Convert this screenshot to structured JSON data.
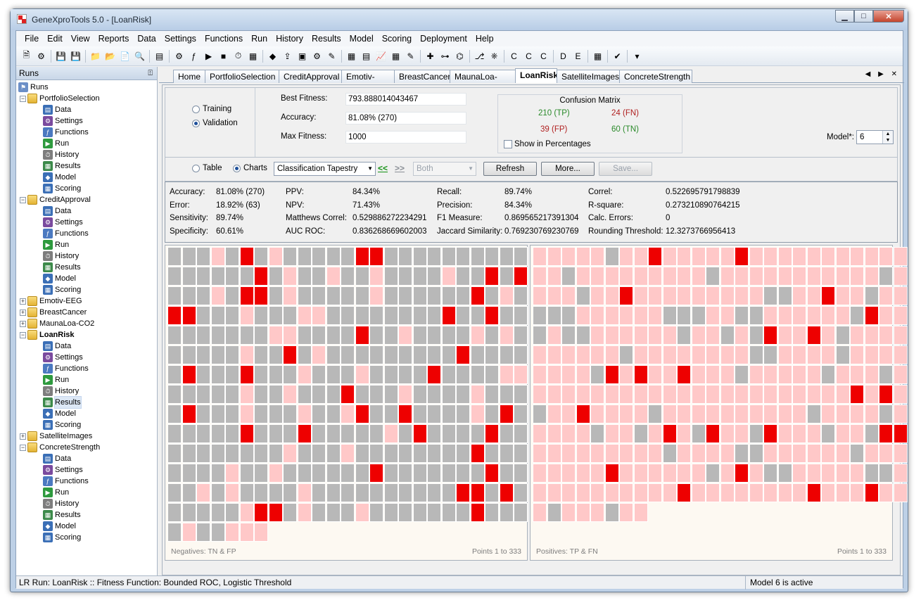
{
  "window": {
    "title": "GeneXproTools 5.0 - [LoanRisk]",
    "min": "▁",
    "max": "□",
    "close": "✕"
  },
  "menu": [
    "File",
    "Edit",
    "View",
    "Reports",
    "Data",
    "Settings",
    "Functions",
    "Run",
    "History",
    "Results",
    "Model",
    "Scoring",
    "Deployment",
    "Help"
  ],
  "toolbar_icons": [
    "new-icon",
    "open-icon",
    "save-icon",
    "save-as-icon",
    "folder-icon",
    "folder-open-icon",
    "copy-icon",
    "print-preview-icon",
    "database-icon",
    "settings-icon",
    "function-icon",
    "run-icon",
    "stop-icon",
    "history-icon",
    "chart-icon",
    "model-icon",
    "export-icon",
    "report-icon",
    "gear-icon",
    "tools-icon",
    "grid-icon",
    "table-icon",
    "chart-line-icon",
    "table2-icon",
    "paint-icon",
    "add-icon",
    "tree-icon",
    "code-icon",
    "network-icon",
    "node-icon",
    "doc-c-icon",
    "doc-c2-icon",
    "doc-c3-icon",
    "doc-d-icon",
    "doc-e-icon",
    "calculator-icon",
    "ok-icon",
    "more-icon"
  ],
  "runs_panel": {
    "title": "Runs",
    "pin": "⍐"
  },
  "tree": {
    "root": "Runs",
    "projects": [
      {
        "name": "PortfolioSelection",
        "expanded": true,
        "children": [
          "Data",
          "Settings",
          "Functions",
          "Run",
          "History",
          "Results",
          "Model",
          "Scoring"
        ]
      },
      {
        "name": "CreditApproval",
        "expanded": true,
        "children": [
          "Data",
          "Settings",
          "Functions",
          "Run",
          "History",
          "Results",
          "Model",
          "Scoring"
        ]
      },
      {
        "name": "Emotiv-EEG",
        "expanded": false,
        "children": []
      },
      {
        "name": "BreastCancer",
        "expanded": false,
        "children": []
      },
      {
        "name": "MaunaLoa-CO2",
        "expanded": false,
        "children": []
      },
      {
        "name": "LoanRisk",
        "expanded": true,
        "active": true,
        "selected_child": "Results",
        "children": [
          "Data",
          "Settings",
          "Functions",
          "Run",
          "History",
          "Results",
          "Model",
          "Scoring"
        ]
      },
      {
        "name": "SatelliteImages",
        "expanded": false,
        "children": []
      },
      {
        "name": "ConcreteStrength",
        "expanded": true,
        "children": [
          "Data",
          "Settings",
          "Functions",
          "Run",
          "History",
          "Results",
          "Model",
          "Scoring"
        ]
      }
    ]
  },
  "doc_tabs": [
    "Home",
    "PortfolioSelection",
    "CreditApproval",
    "Emotiv-EEG",
    "BreastCancer",
    "MaunaLoa-CO2",
    "LoanRisk",
    "SatelliteImages",
    "ConcreteStrength"
  ],
  "active_tab": "LoanRisk",
  "tab_nav": "◀ ▶ ✕",
  "dataset": {
    "training": "Training",
    "validation": "Validation",
    "selected": "Validation"
  },
  "fitness": {
    "best_label": "Best Fitness:",
    "best_value": "793.888014043467",
    "accuracy_label": "Accuracy:",
    "accuracy_value": "81.08% (270)",
    "max_label": "Max Fitness:",
    "max_value": "1000"
  },
  "confusion_matrix": {
    "title": "Confusion Matrix",
    "tp": "210 (TP)",
    "fn": "24 (FN)",
    "fp": "39 (FP)",
    "tn": "60 (TN)",
    "show_pct": "Show in Percentages",
    "tp_color": "#2a8a2a",
    "fn_color": "#b02020"
  },
  "model": {
    "label": "Model*:",
    "value": "6"
  },
  "options": {
    "table": "Table",
    "charts": "Charts",
    "view_selected": "Charts",
    "chart_type": "Classification Tapestry",
    "prev": "<<",
    "next": ">>",
    "filter": "Both",
    "refresh": "Refresh",
    "more": "More...",
    "save": "Save..."
  },
  "stats": [
    {
      "label": "Accuracy:",
      "value": "81.08% (270)"
    },
    {
      "label": "Error:",
      "value": "18.92% (63)"
    },
    {
      "label": "Sensitivity:",
      "value": "89.74%"
    },
    {
      "label": "Specificity:",
      "value": "60.61%"
    },
    {
      "label": "PPV:",
      "value": "84.34%"
    },
    {
      "label": "NPV:",
      "value": "71.43%"
    },
    {
      "label": "Matthews Correl:",
      "value": "0.529886272234291"
    },
    {
      "label": "AUC ROC:",
      "value": "0.836268669602003"
    },
    {
      "label": "Recall:",
      "value": "89.74%"
    },
    {
      "label": "Precision:",
      "value": "84.34%"
    },
    {
      "label": "F1 Measure:",
      "value": "0.869565217391304"
    },
    {
      "label": "Jaccard Similarity:",
      "value": "0.769230769230769"
    },
    {
      "label": "Correl:",
      "value": "0.522695791798839"
    },
    {
      "label": "R-square:",
      "value": "0.273210890764215"
    },
    {
      "label": "Calc. Errors:",
      "value": "0"
    },
    {
      "label": "Rounding Threshold:",
      "value": "12.3273766956413"
    }
  ],
  "tapestry_colors": {
    "g": "#b8b8b8",
    "p": "#ffc8c8",
    "r": "#ee0000"
  },
  "tapestry_negatives": {
    "caption": "Negatives: TN & FP",
    "points": "Points 1 to 333",
    "rows": [
      "gggpgrgpgggggrrgggggggggg",
      "ggggggrgpggpggpggggpggrgr",
      "gggpgrrgpgggggpggggggrgpg",
      "rrgggpgggppggggggggrggrgg",
      "gggggggppggggrggpggggpgpg",
      "gggggpggrgpgggggggggrgggg",
      "grgggrgggpgggpggggrggggpp",
      "gggggpggpgggrgggpggggpggg",
      "grgggpgggpggprggrggggpgrg",
      "gggggrgggrgggggpgrggggrgg",
      "ggggggggpgggpggggggggrggg",
      "ggggpggpggggggrgggggggrgg",
      "ggpgpggggpggggggggggrrgrg",
      "gggggprrgpgggpgggggggrggg",
      "gpggppp"
    ]
  },
  "tapestry_positives": {
    "caption": "Positives: TP & FN",
    "points": "Points 1 to 333",
    "rows": [
      "pppppgpprppppprppppppppppp",
      "ppgpppppppppgpppppppppppgp",
      "pppgpprpppppppppggpprppgpp",
      "gggppppppgggppggppppppgrpp",
      "gpggppppppgppgpgrpprpgpppp",
      "ppppppgppppppppggppppgpppp",
      "ppppgrprpprpppgpppppgpppgp",
      "pppppppppppppppppppppprprp",
      "gpprppppgppppppppppgppppgp",
      "ppppgppgprpgrppgrpppgppgrr",
      "pppppppppgppppggppppppgppp",
      "ppppprppppppgprpggpppppggp",
      "pppppppppprpppppppprppprpp",
      "pgpppgpp"
    ]
  },
  "status": {
    "left": "LR Run: LoanRisk :: Fitness Function: Bounded ROC, Logistic Threshold",
    "right": "Model 6 is active"
  }
}
